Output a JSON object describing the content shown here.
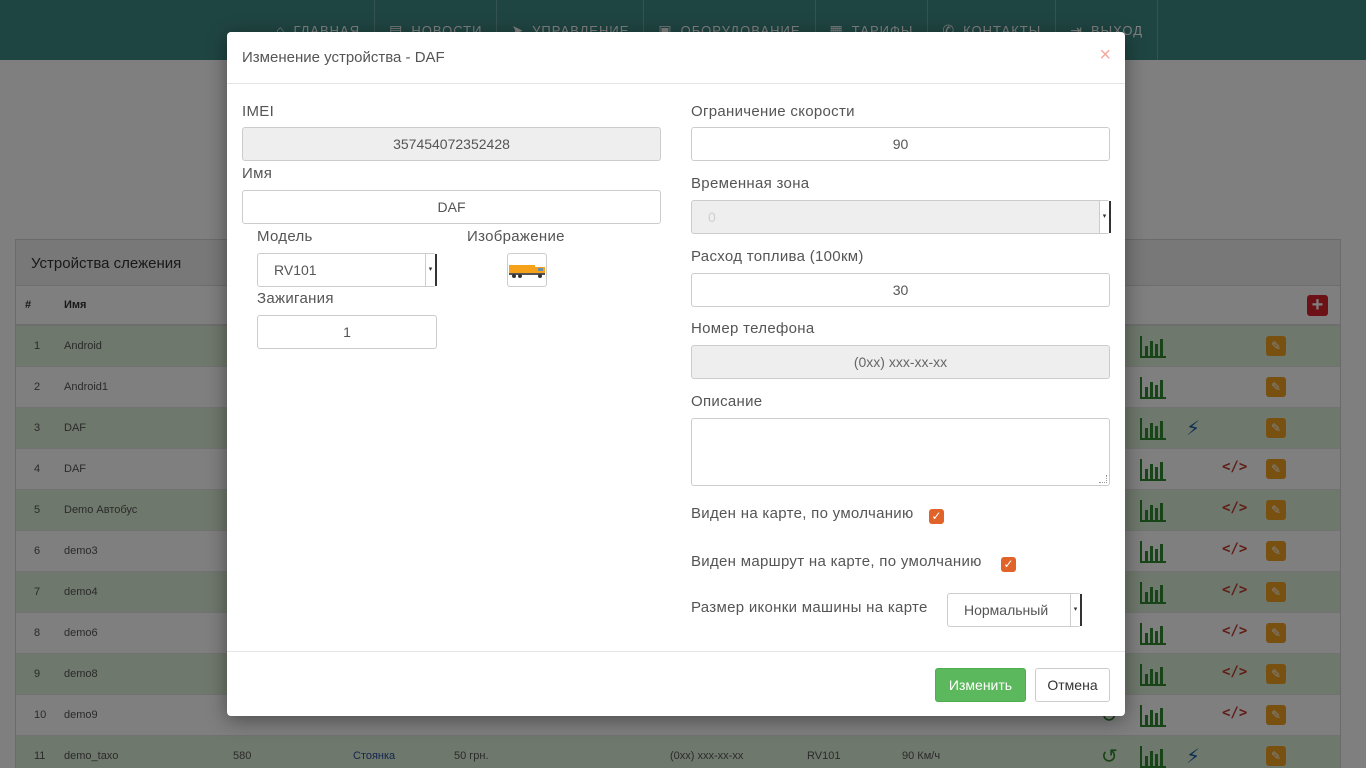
{
  "nav": {
    "items": [
      {
        "label": "Главная",
        "icon": "home-icon"
      },
      {
        "label": "Новости",
        "icon": "newspaper-icon"
      },
      {
        "label": "Управление",
        "icon": "send-icon"
      },
      {
        "label": "Оборудование",
        "icon": "printer-icon"
      },
      {
        "label": "Тарифы",
        "icon": "money-icon"
      },
      {
        "label": "Контакты",
        "icon": "phone-icon"
      },
      {
        "label": "Выход",
        "icon": "exit-icon"
      }
    ]
  },
  "panel": {
    "title": "Устройства слежения",
    "col_num": "#",
    "col_name": "Имя",
    "rows": [
      {
        "num": "1",
        "name": "Android"
      },
      {
        "num": "2",
        "name": "Android1"
      },
      {
        "num": "3",
        "name": "DAF"
      },
      {
        "num": "4",
        "name": "DAF"
      },
      {
        "num": "5",
        "name": "Demo Автобус"
      },
      {
        "num": "6",
        "name": "demo3"
      },
      {
        "num": "7",
        "name": "demo4"
      },
      {
        "num": "8",
        "name": "demo6"
      },
      {
        "num": "9",
        "name": "demo8"
      },
      {
        "num": "10",
        "name": "demo9"
      },
      {
        "num": "11",
        "name": "demo_taxo",
        "count": "580",
        "status": "Стоянка",
        "price": "50 грн.",
        "phone": "(0xx) xxx-xx-xx",
        "model": "RV101",
        "speed": "90 Км/ч"
      }
    ]
  },
  "modal": {
    "title": "Изменение устройства - DAF",
    "close": "×",
    "imei_label": "IMEI",
    "imei_value": "357454072352428",
    "name_label": "Имя",
    "name_value": "DAF",
    "model_label": "Модель",
    "model_value": "RV101",
    "image_label": "Изображение",
    "ignition_label": "Зажигания",
    "ignition_value": "1",
    "speed_label": "Ограничение скорости",
    "speed_value": "90",
    "timezone_label": "Временная зона",
    "timezone_value": "0",
    "fuel_label": "Расход топлива (100км)",
    "fuel_value": "30",
    "phone_label": "Номер телефона",
    "phone_placeholder": "(0xx) xxx-xx-xx",
    "description_label": "Описание",
    "visible_label": "Виден на карте, по умолчанию",
    "route_label": "Виден маршрут на карте, по умолчанию",
    "icon_size_label": "Размер иконки машины на карте",
    "icon_size_value": "Нормальный",
    "submit": "Изменить",
    "cancel": "Отмена"
  },
  "colors": {
    "topbar": "#3e8a84",
    "row_alt": "#dff0d8",
    "primary_button": "#5cb85c",
    "checkbox": "#e0632a",
    "edit_icon": "#f0a020"
  }
}
